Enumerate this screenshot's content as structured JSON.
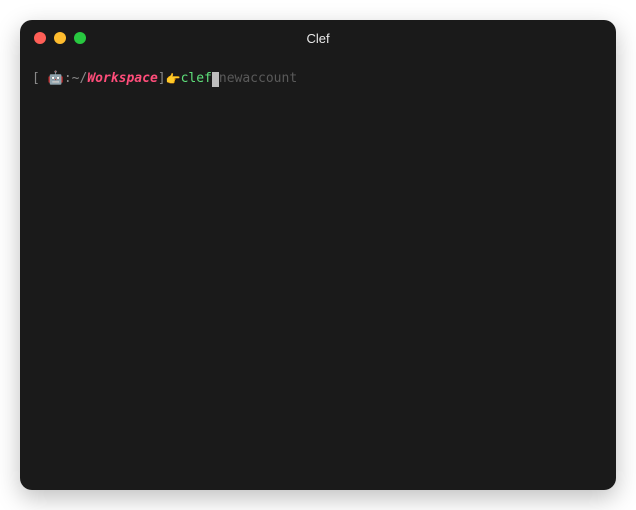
{
  "window": {
    "title": "Clef"
  },
  "prompt": {
    "open_bracket": "[ ",
    "host_emoji": "🤖",
    "path_prefix": ":",
    "path_tilde": "~/",
    "workspace": "Workspace",
    "close_bracket": "]",
    "arrow_emoji": "👉",
    "command": "clef",
    "autosuggest": "newaccount"
  }
}
